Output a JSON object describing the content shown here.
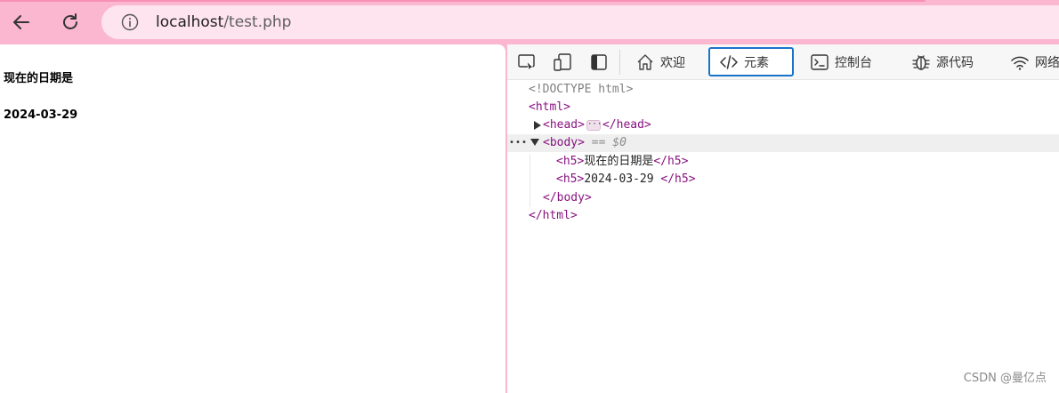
{
  "browser": {
    "url_host": "localhost",
    "url_path": "/test.php"
  },
  "page": {
    "heading1": "现在的日期是",
    "heading2": "2024-03-29"
  },
  "devtools": {
    "tabs": {
      "welcome": "欢迎",
      "elements": "元素",
      "console": "控制台",
      "sources": "源代码",
      "network": "网络"
    },
    "dom": {
      "doctype": "<!DOCTYPE html>",
      "html_open": "<html>",
      "head_open": "<head>",
      "head_ellipsis": "···",
      "head_close": "</head>",
      "body_open": "<body>",
      "body_selected_marker": "== $0",
      "row_dots": "•••",
      "h5_open": "<h5>",
      "h5_text_1": "现在的日期是",
      "h5_close": "</h5>",
      "h5_text_2": "2024-03-29 ",
      "body_close": "</body>",
      "html_close": "</html>"
    }
  },
  "watermark": "CSDN @曼亿点",
  "colors": {
    "browser_frame": "#fbb6d0",
    "address_bar": "#fde4ee",
    "tag_color": "#881280",
    "active_tab_border": "#1a73c9"
  }
}
